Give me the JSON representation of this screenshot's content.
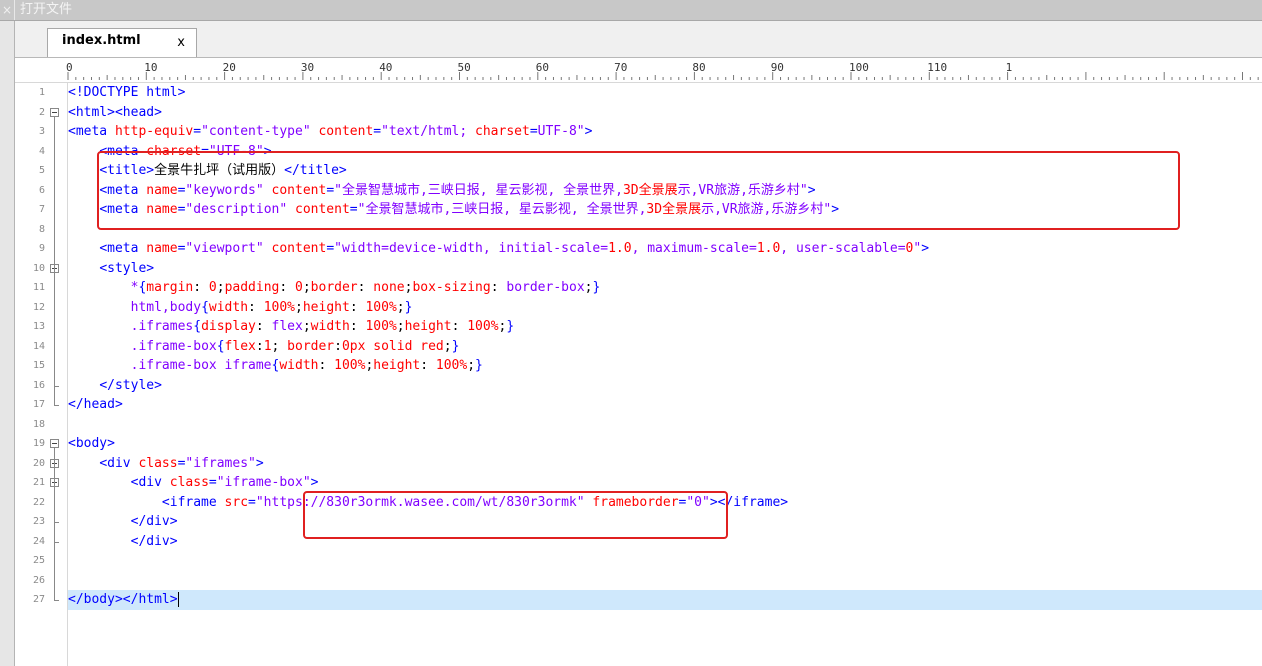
{
  "window": {
    "title": "打开文件",
    "close_glyph": "×"
  },
  "tab": {
    "label": "index.html",
    "close_glyph": "x"
  },
  "ruler": {
    "labels": [
      "0",
      "10",
      "20",
      "30",
      "40",
      "50",
      "60",
      "70",
      "80",
      "90",
      "100",
      "110",
      "1"
    ]
  },
  "editor": {
    "current_line": 27,
    "lines": [
      [
        [
          "t",
          "<!DOCTYPE html>"
        ]
      ],
      [
        [
          "t",
          "<html><head>"
        ]
      ],
      [
        [
          "t",
          "<meta "
        ],
        [
          "a",
          "http-equiv"
        ],
        [
          "t",
          "="
        ],
        [
          "v",
          "\"content-type\""
        ],
        [
          "t",
          " "
        ],
        [
          "a",
          "content"
        ],
        [
          "t",
          "="
        ],
        [
          "v",
          "\"text/html; "
        ],
        [
          "a",
          "charset"
        ],
        [
          "t",
          "="
        ],
        [
          "v",
          "UTF-8\""
        ],
        [
          "t",
          ">"
        ]
      ],
      [
        [
          "p",
          "    "
        ],
        [
          "t",
          "<meta "
        ],
        [
          "a",
          "charset"
        ],
        [
          "t",
          "="
        ],
        [
          "v",
          "\"UTF-8\""
        ],
        [
          "t",
          ">"
        ]
      ],
      [
        [
          "p",
          "    "
        ],
        [
          "t",
          "<title>"
        ],
        [
          "p",
          "全景牛扎坪（试用版）"
        ],
        [
          "t",
          "</title>"
        ]
      ],
      [
        [
          "p",
          "    "
        ],
        [
          "t",
          "<meta "
        ],
        [
          "a",
          "name"
        ],
        [
          "t",
          "="
        ],
        [
          "v",
          "\"keywords\""
        ],
        [
          "t",
          " "
        ],
        [
          "a",
          "content"
        ],
        [
          "t",
          "="
        ],
        [
          "v",
          "\"全景智慧城市,三峡日报, 星云影视, 全景世界,"
        ],
        [
          "a",
          "3D全景展"
        ],
        [
          "v",
          "示,VR旅游,乐游乡村\""
        ],
        [
          "t",
          ">"
        ]
      ],
      [
        [
          "p",
          "    "
        ],
        [
          "t",
          "<meta "
        ],
        [
          "a",
          "name"
        ],
        [
          "t",
          "="
        ],
        [
          "v",
          "\"description\""
        ],
        [
          "t",
          " "
        ],
        [
          "a",
          "content"
        ],
        [
          "t",
          "="
        ],
        [
          "v",
          "\"全景智慧城市,三峡日报, 星云影视, 全景世界,"
        ],
        [
          "a",
          "3D全景展"
        ],
        [
          "v",
          "示,VR旅游,乐游乡村\""
        ],
        [
          "t",
          ">"
        ]
      ],
      [
        [
          "p",
          ""
        ]
      ],
      [
        [
          "p",
          "    "
        ],
        [
          "t",
          "<meta "
        ],
        [
          "a",
          "name"
        ],
        [
          "t",
          "="
        ],
        [
          "v",
          "\"viewport\""
        ],
        [
          "t",
          " "
        ],
        [
          "a",
          "content"
        ],
        [
          "t",
          "="
        ],
        [
          "v",
          "\"width=device-width, initial-scale="
        ],
        [
          "a",
          "1.0"
        ],
        [
          "v",
          ", maximum-scale="
        ],
        [
          "a",
          "1.0"
        ],
        [
          "v",
          ", user-scalable="
        ],
        [
          "a",
          "0"
        ],
        [
          "v",
          "\""
        ],
        [
          "t",
          ">"
        ]
      ],
      [
        [
          "p",
          "    "
        ],
        [
          "t",
          "<style>"
        ]
      ],
      [
        [
          "p",
          "        "
        ],
        [
          "v",
          "*"
        ],
        [
          "t",
          "{"
        ],
        [
          "a",
          "margin"
        ],
        [
          "p",
          ": "
        ],
        [
          "a",
          "0"
        ],
        [
          "p",
          ";"
        ],
        [
          "a",
          "padding"
        ],
        [
          "p",
          ": "
        ],
        [
          "a",
          "0"
        ],
        [
          "p",
          ";"
        ],
        [
          "a",
          "border"
        ],
        [
          "p",
          ": "
        ],
        [
          "a",
          "none"
        ],
        [
          "p",
          ";"
        ],
        [
          "a",
          "box-sizing"
        ],
        [
          "p",
          ": "
        ],
        [
          "v",
          "border-box"
        ],
        [
          "p",
          ";"
        ],
        [
          "t",
          "}"
        ]
      ],
      [
        [
          "p",
          "        "
        ],
        [
          "v",
          "html,body"
        ],
        [
          "t",
          "{"
        ],
        [
          "a",
          "width"
        ],
        [
          "p",
          ": "
        ],
        [
          "a",
          "100%"
        ],
        [
          "p",
          ";"
        ],
        [
          "a",
          "height"
        ],
        [
          "p",
          ": "
        ],
        [
          "a",
          "100%"
        ],
        [
          "p",
          ";"
        ],
        [
          "t",
          "}"
        ]
      ],
      [
        [
          "p",
          "        "
        ],
        [
          "v",
          ".iframes"
        ],
        [
          "t",
          "{"
        ],
        [
          "a",
          "display"
        ],
        [
          "p",
          ": "
        ],
        [
          "v",
          "flex"
        ],
        [
          "p",
          ";"
        ],
        [
          "a",
          "width"
        ],
        [
          "p",
          ": "
        ],
        [
          "a",
          "100%"
        ],
        [
          "p",
          ";"
        ],
        [
          "a",
          "height"
        ],
        [
          "p",
          ": "
        ],
        [
          "a",
          "100%"
        ],
        [
          "p",
          ";"
        ],
        [
          "t",
          "}"
        ]
      ],
      [
        [
          "p",
          "        "
        ],
        [
          "v",
          ".iframe-box"
        ],
        [
          "t",
          "{"
        ],
        [
          "a",
          "flex"
        ],
        [
          "p",
          ":"
        ],
        [
          "a",
          "1"
        ],
        [
          "p",
          "; "
        ],
        [
          "a",
          "border"
        ],
        [
          "p",
          ":"
        ],
        [
          "a",
          "0px"
        ],
        [
          "p",
          " "
        ],
        [
          "a",
          "solid"
        ],
        [
          "p",
          " "
        ],
        [
          "a",
          "red"
        ],
        [
          "p",
          ";"
        ],
        [
          "t",
          "}"
        ]
      ],
      [
        [
          "p",
          "        "
        ],
        [
          "v",
          ".iframe-box iframe"
        ],
        [
          "t",
          "{"
        ],
        [
          "a",
          "width"
        ],
        [
          "p",
          ": "
        ],
        [
          "a",
          "100%"
        ],
        [
          "p",
          ";"
        ],
        [
          "a",
          "height"
        ],
        [
          "p",
          ": "
        ],
        [
          "a",
          "100%"
        ],
        [
          "p",
          ";"
        ],
        [
          "t",
          "}"
        ]
      ],
      [
        [
          "p",
          "    "
        ],
        [
          "t",
          "</style>"
        ]
      ],
      [
        [
          "t",
          "</head>"
        ]
      ],
      [
        [
          "p",
          ""
        ]
      ],
      [
        [
          "t",
          "<body>"
        ]
      ],
      [
        [
          "p",
          "    "
        ],
        [
          "t",
          "<div "
        ],
        [
          "a",
          "class"
        ],
        [
          "t",
          "="
        ],
        [
          "v",
          "\"iframes\""
        ],
        [
          "t",
          ">"
        ]
      ],
      [
        [
          "p",
          "        "
        ],
        [
          "t",
          "<div "
        ],
        [
          "a",
          "class"
        ],
        [
          "t",
          "="
        ],
        [
          "v",
          "\"iframe-box\""
        ],
        [
          "t",
          ">"
        ]
      ],
      [
        [
          "p",
          "            "
        ],
        [
          "t",
          "<iframe "
        ],
        [
          "a",
          "src"
        ],
        [
          "t",
          "="
        ],
        [
          "v",
          "\"https://830r3ormk.wasee.com/wt/830r3ormk\""
        ],
        [
          "t",
          " "
        ],
        [
          "a",
          "frameborder"
        ],
        [
          "t",
          "="
        ],
        [
          "v",
          "\"0\""
        ],
        [
          "t",
          "></iframe>"
        ]
      ],
      [
        [
          "p",
          "        "
        ],
        [
          "t",
          "</div>"
        ]
      ],
      [
        [
          "p",
          "        "
        ],
        [
          "t",
          "</div>"
        ]
      ],
      [
        [
          "p",
          ""
        ]
      ],
      [
        [
          "p",
          ""
        ]
      ],
      [
        [
          "t",
          "</body></html>"
        ]
      ]
    ]
  },
  "colors": {
    "tag": "#0000ff",
    "attr": "#ff0000",
    "value": "#8000ff",
    "highlight_box": "#e02020",
    "current_line_bg": "#cfe8fc"
  }
}
